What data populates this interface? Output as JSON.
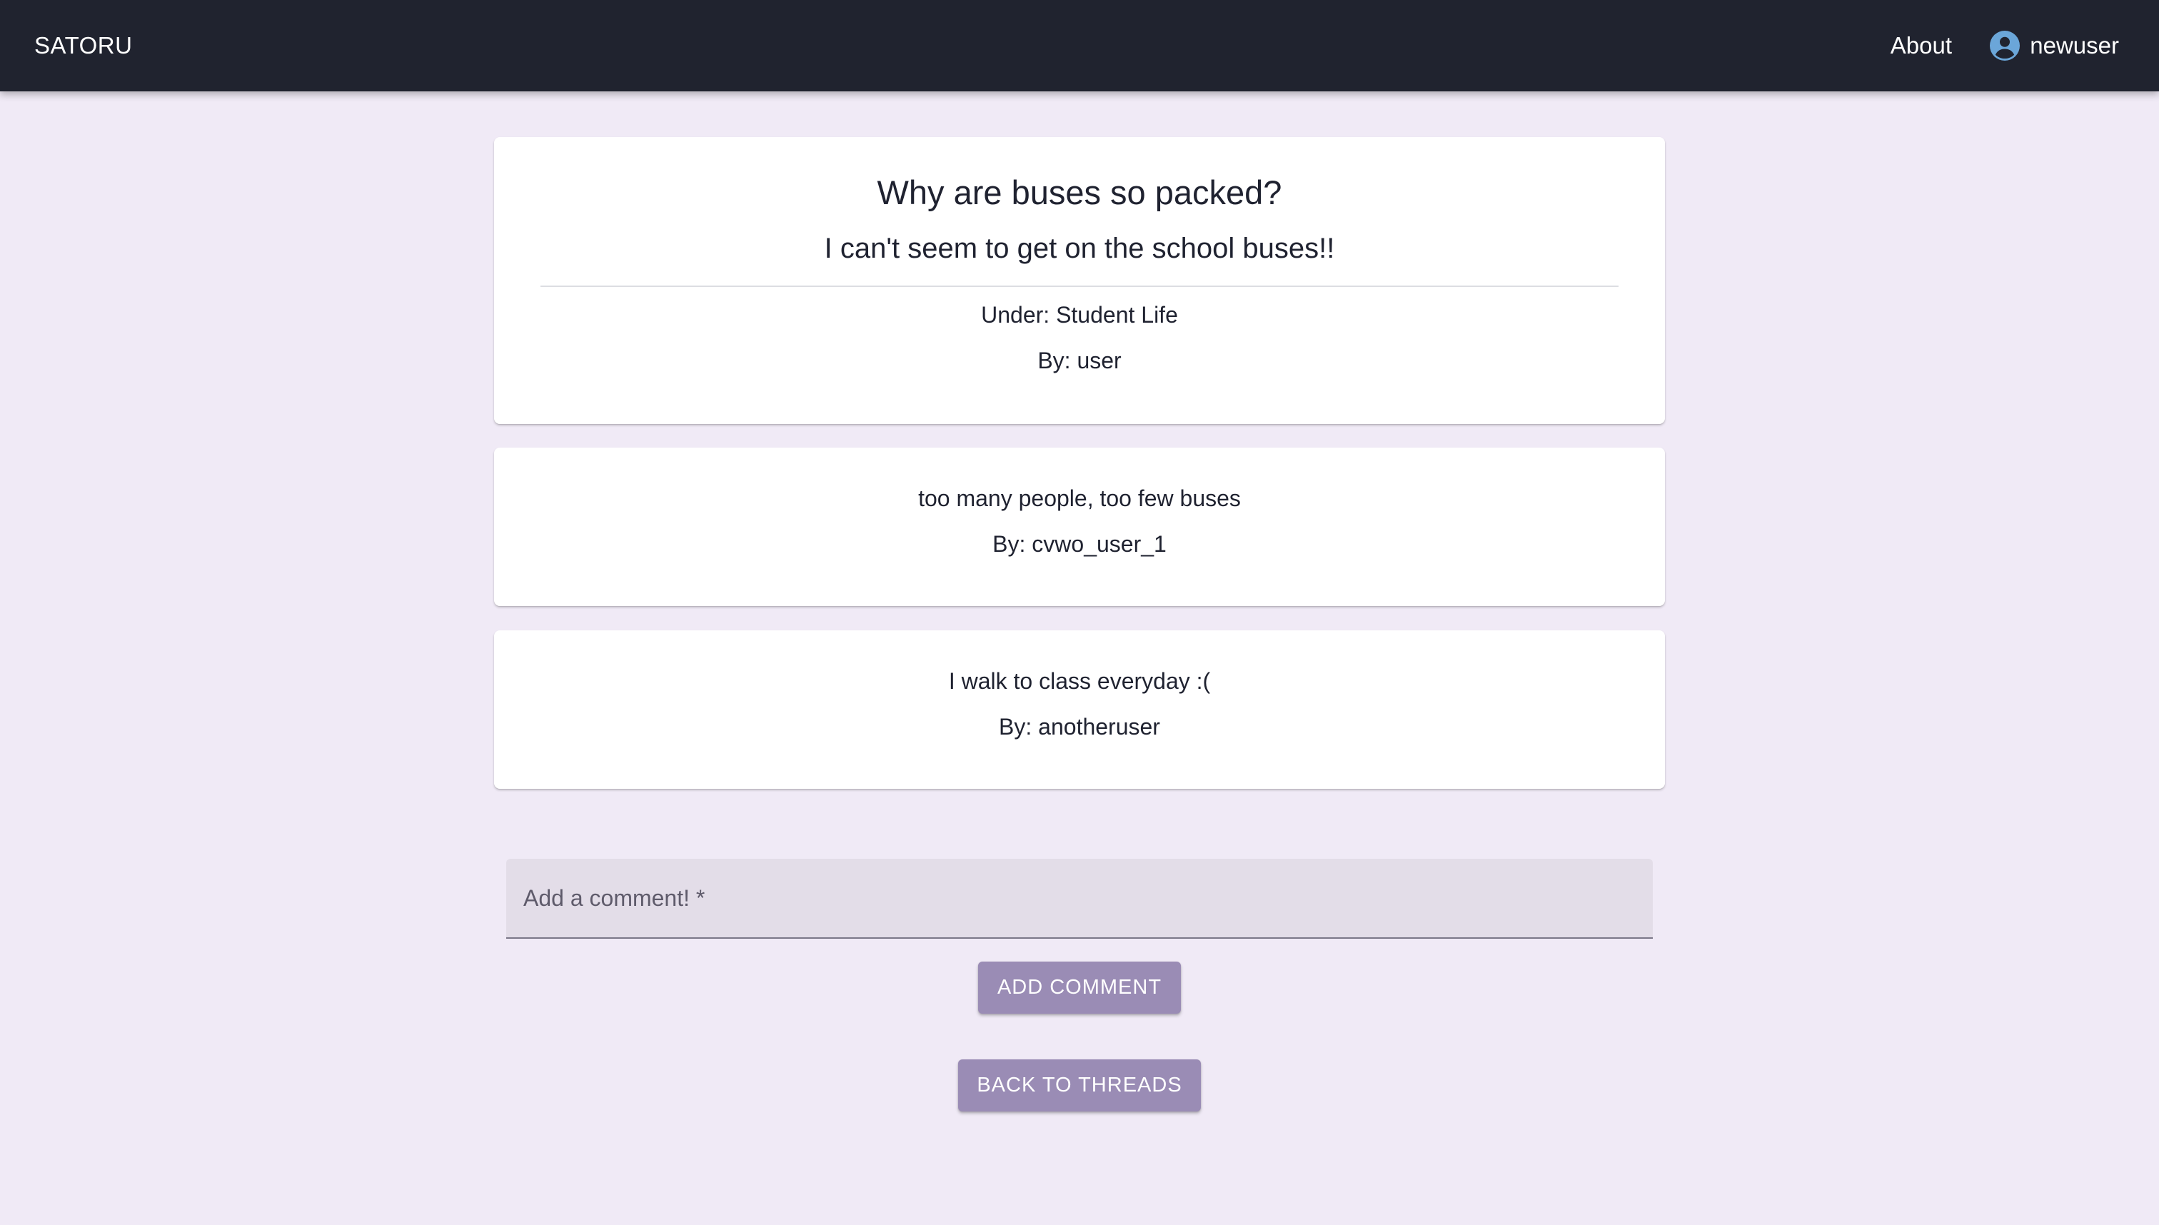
{
  "appbar": {
    "brand": "SATORU",
    "about_label": "About",
    "username": "newuser",
    "user_icon": "account-circle-icon"
  },
  "thread": {
    "title": "Why are buses so packed?",
    "body": "I can't seem to get on the school buses!!",
    "category_line": "Under: Student Life",
    "author_line": "By: user"
  },
  "comments": [
    {
      "text": "too many people, too few buses",
      "author_line": "By: cvwo_user_1"
    },
    {
      "text": "I walk to class everyday :(",
      "author_line": "By: anotheruser"
    }
  ],
  "comment_form": {
    "label": "Add a comment! *",
    "value": ""
  },
  "buttons": {
    "add_comment": "ADD COMMENT",
    "back_to_threads": "BACK TO THREADS"
  },
  "colors": {
    "appbar_bg": "#20232f",
    "page_bg": "#f0eaf6",
    "button_bg": "#9a8cb5",
    "user_icon": "#6ba6d9"
  }
}
